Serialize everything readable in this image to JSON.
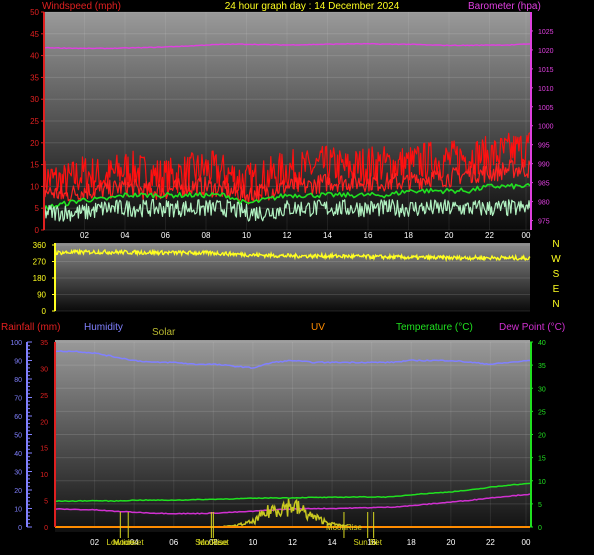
{
  "title": "24 hour graph day : 14 December 2024",
  "colors": {
    "wind": "#ff2020",
    "gust": "#ff1010",
    "avg_wind": "#b0f0c0",
    "barometer": "#e040e0",
    "wind_dir": "#ffff20",
    "humidity": "#8080ff",
    "temperature": "#20e020",
    "dew_point": "#d030d0",
    "rainfall": "#ff4040",
    "uv": "#ff8c00",
    "solar": "#c8c820",
    "axis_text_left": "#e02020",
    "tick_text": "#ffffff"
  },
  "chart_data": [
    {
      "type": "line",
      "panel": "wind-barometer",
      "y_left_label": "Windspeed (mph)",
      "y_right_label": "Barometer (hpa)",
      "x_ticks": [
        "02",
        "04",
        "06",
        "08",
        "10",
        "12",
        "14",
        "16",
        "18",
        "20",
        "22",
        "00"
      ],
      "y_left_ticks": [
        0,
        5,
        10,
        15,
        20,
        25,
        30,
        35,
        40,
        45,
        50
      ],
      "y_left_range": [
        0,
        50
      ],
      "y_right_ticks": [
        975,
        980,
        985,
        990,
        995,
        1000,
        1005,
        1010,
        1015,
        1020,
        1025
      ],
      "y_right_range": [
        972.5,
        1030
      ],
      "hours": [
        0,
        1,
        2,
        3,
        4,
        5,
        6,
        7,
        8,
        9,
        10,
        11,
        12,
        13,
        14,
        15,
        16,
        17,
        18,
        19,
        20,
        21,
        22,
        23,
        24
      ],
      "series": [
        {
          "name": "gust",
          "color_key": "gust",
          "values": [
            12,
            11,
            13,
            12,
            14,
            13,
            12,
            13,
            14,
            13,
            11,
            12,
            14,
            14,
            15,
            14,
            15,
            15,
            15,
            16,
            16,
            17,
            17,
            18,
            19
          ]
        },
        {
          "name": "wind",
          "color_key": "wind",
          "values": [
            9,
            8,
            9,
            9,
            10,
            9,
            9,
            10,
            10,
            9,
            8,
            9,
            10,
            10,
            11,
            11,
            11,
            11,
            11,
            12,
            12,
            13,
            13,
            14,
            14
          ]
        },
        {
          "name": "average",
          "color_key": "temperature",
          "values": [
            5,
            6,
            7,
            7,
            8,
            8,
            8,
            8,
            8,
            8,
            6,
            7,
            8,
            8,
            8,
            8,
            8,
            8,
            9,
            9,
            9,
            9,
            10,
            10,
            10
          ]
        },
        {
          "name": "gust-low",
          "color_key": "avg_wind",
          "values": [
            4,
            4,
            4,
            5,
            5,
            5,
            5,
            5,
            5,
            5,
            4,
            4,
            5,
            5,
            5,
            5,
            5,
            5,
            5,
            5,
            5,
            5,
            5,
            5,
            5
          ]
        },
        {
          "name": "barometer",
          "color_key": "barometer",
          "axis": "right",
          "values": [
            1020.6,
            1020.5,
            1020.4,
            1020.4,
            1020.5,
            1020.6,
            1020.8,
            1021.0,
            1021.3,
            1021.5,
            1021.5,
            1021.4,
            1021.3,
            1021.4,
            1021.5,
            1021.6,
            1021.6,
            1021.5,
            1021.5,
            1021.3,
            1021.2,
            1021.2,
            1021.3,
            1021.3,
            1021.6
          ]
        }
      ]
    },
    {
      "type": "scatter",
      "panel": "wind-direction",
      "y_ticks": [
        0,
        90,
        180,
        270,
        360
      ],
      "y_range": [
        0,
        360
      ],
      "right_labels": [
        "N",
        "W",
        "S",
        "E",
        "N"
      ],
      "hours": [
        0,
        2,
        4,
        6,
        8,
        10,
        12,
        14,
        16,
        18,
        20,
        22,
        24
      ],
      "series": [
        {
          "name": "direction",
          "color_key": "wind_dir",
          "values": [
            318,
            322,
            320,
            318,
            316,
            306,
            300,
            300,
            296,
            292,
            290,
            290,
            288
          ]
        }
      ]
    },
    {
      "type": "line",
      "panel": "temp-humidity-rain",
      "labels": {
        "rainfall": "Rainfall (mm)",
        "humidity": "Humidity",
        "solar": "Solar",
        "uv": "UV",
        "temperature": "Temperature (°C)",
        "dew_point": "Dew Point (°C)"
      },
      "x_ticks": [
        "02",
        "04",
        "06",
        "08",
        "10",
        "12",
        "14",
        "16",
        "18",
        "20",
        "22",
        "00"
      ],
      "humidity_ticks": [
        0,
        10,
        20,
        30,
        40,
        50,
        60,
        70,
        80,
        90,
        100
      ],
      "rain_ticks": [
        0,
        5,
        10,
        15,
        20,
        25,
        30,
        35
      ],
      "temp_ticks": [
        0,
        5,
        10,
        15,
        20,
        25,
        30,
        35,
        40
      ],
      "markers": [
        {
          "label": "Lowtide",
          "hour": 3.3
        },
        {
          "label": "Moonset",
          "hour": 3.7
        },
        {
          "label": "Sun Rise",
          "hour": 7.9
        },
        {
          "label": "Moonset",
          "hour": 8.0
        },
        {
          "label": "MoonRise",
          "hour": 14.6
        },
        {
          "label": "Sun Set",
          "hour": 15.8
        },
        {
          "label": "Hi",
          "hour": 16.1
        }
      ],
      "hours": [
        0,
        1,
        2,
        3,
        4,
        5,
        6,
        7,
        8,
        9,
        10,
        11,
        12,
        13,
        14,
        15,
        16,
        17,
        18,
        19,
        20,
        21,
        22,
        23,
        24
      ],
      "series": [
        {
          "name": "humidity",
          "color_key": "humidity",
          "axis": "humidity",
          "values": [
            95,
            95,
            94,
            92,
            90,
            89,
            89,
            88,
            88,
            87,
            86,
            89,
            90,
            89,
            89,
            89,
            89,
            89,
            90,
            90,
            90,
            89,
            88,
            89,
            90
          ]
        },
        {
          "name": "temperature",
          "color_key": "temperature",
          "axis": "temp",
          "values": [
            5.6,
            5.6,
            5.7,
            5.6,
            5.8,
            5.8,
            5.8,
            5.9,
            6.0,
            6.1,
            6.2,
            6.3,
            6.3,
            6.4,
            6.4,
            6.5,
            6.5,
            6.5,
            7.0,
            7.3,
            7.6,
            8.0,
            8.6,
            9.1,
            9.4
          ]
        },
        {
          "name": "dew point",
          "color_key": "dew_point",
          "axis": "temp",
          "values": [
            3.9,
            3.8,
            3.7,
            3.4,
            3.2,
            3.0,
            2.9,
            2.9,
            3.0,
            3.2,
            3.4,
            3.7,
            3.9,
            4.0,
            4.0,
            4.1,
            4.2,
            4.3,
            4.6,
            5.0,
            5.4,
            5.8,
            6.3,
            6.7,
            7.1
          ]
        },
        {
          "name": "solar",
          "color_key": "solar",
          "axis": "temp",
          "values": [
            0,
            0,
            0,
            0,
            0,
            0,
            0,
            0,
            0,
            0.2,
            1.0,
            3.5,
            4.2,
            2.0,
            0.6,
            0,
            0,
            0,
            0,
            0,
            0,
            0,
            0,
            0,
            0
          ]
        },
        {
          "name": "uv",
          "color_key": "uv",
          "axis": "temp",
          "values": [
            0,
            0,
            0,
            0,
            0,
            0,
            0,
            0,
            0,
            0,
            0,
            0,
            0,
            0,
            0,
            0,
            0,
            0,
            0,
            0,
            0,
            0,
            0,
            0,
            0
          ]
        }
      ]
    }
  ]
}
